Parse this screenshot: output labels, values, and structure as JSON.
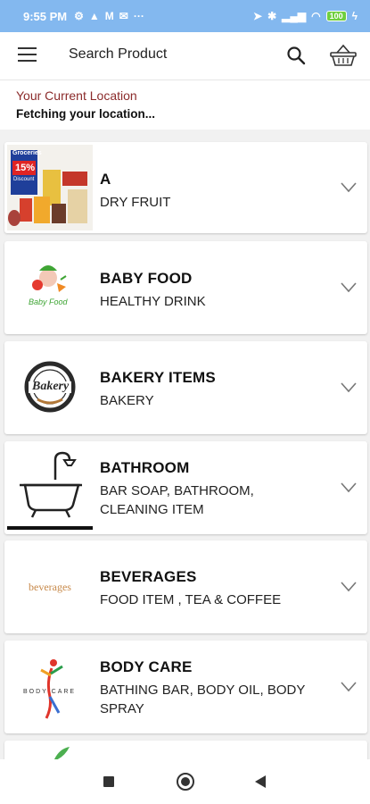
{
  "status_bar": {
    "time": "9:55 PM",
    "left_icons": [
      "settings-icon",
      "notification-icon",
      "gmail-icon",
      "mail-icon"
    ],
    "more": "···",
    "battery": "100"
  },
  "app_bar": {
    "search_label": "Search Product"
  },
  "location": {
    "title": "Your Current Location",
    "value": "Fetching your location..."
  },
  "categories": [
    {
      "name": "A",
      "subtitle": "DRY FRUIT",
      "image": "groceries-thumbnail"
    },
    {
      "name": "BABY FOOD",
      "subtitle": "HEALTHY DRINK",
      "image": "baby-food-logo"
    },
    {
      "name": "BAKERY ITEMS",
      "subtitle": "BAKERY",
      "image": "bakery-logo"
    },
    {
      "name": "BATHROOM",
      "subtitle": "BAR SOAP, BATHROOM, CLEANING ITEM",
      "image": "bathtub-illustration"
    },
    {
      "name": "BEVERAGES",
      "subtitle": "FOOD ITEM , TEA & COFFEE",
      "image": "beverages-logo"
    },
    {
      "name": "BODY CARE",
      "subtitle": "BATHING BAR, BODY OIL, BODY SPRAY",
      "image": "body-care-logo"
    }
  ],
  "thumb_text": {
    "groceries": "Groceries",
    "discount": "15%",
    "discount_label": "Discount",
    "baby_food": "Baby Food",
    "bakery": "Bakery",
    "beverages": "beverages",
    "body_care": "BODY CARE"
  },
  "colors": {
    "status_bar": "#83b8ef",
    "location_title": "#8b2b2b",
    "battery": "#6fcf3f"
  }
}
